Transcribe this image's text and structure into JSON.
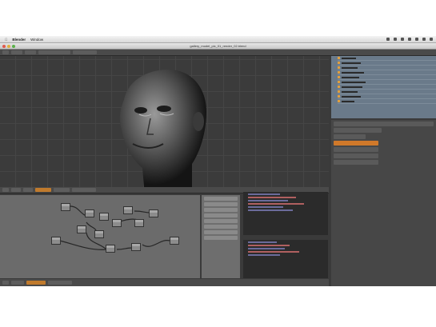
{
  "menubar": {
    "app_name": "Blender",
    "window_menu": "Window"
  },
  "window": {
    "title": "gallery_model_pic_01_render_02.blend"
  },
  "colors": {
    "accent": "#d0792a",
    "outliner": "#6a7a8a",
    "viewport": "#3b3b3b"
  },
  "icons": [
    "apple-icon",
    "close-dot-icon",
    "minimize-dot-icon",
    "zoom-dot-icon",
    "bust-head-3d"
  ]
}
